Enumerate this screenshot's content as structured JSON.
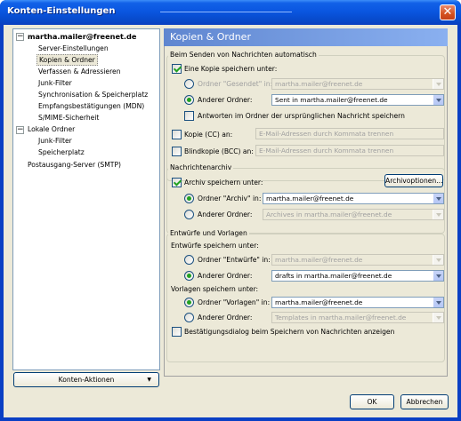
{
  "window": {
    "title": "Konten-Einstellungen",
    "close_glyph": "✕"
  },
  "tree": {
    "items": [
      {
        "label": "martha.mailer@freenet.de",
        "toggle": "−"
      },
      {
        "label": "Server-Einstellungen"
      },
      {
        "label": "Kopien & Ordner"
      },
      {
        "label": "Verfassen & Adressieren"
      },
      {
        "label": "Junk-Filter"
      },
      {
        "label": "Synchronisation & Speicherplatz"
      },
      {
        "label": "Empfangsbestätigungen (MDN)"
      },
      {
        "label": "S/MIME-Sicherheit"
      },
      {
        "label": "Lokale Ordner",
        "toggle": "−"
      },
      {
        "label": "Junk-Filter"
      },
      {
        "label": "Speicherplatz"
      },
      {
        "label": "Postausgang-Server (SMTP)"
      }
    ],
    "accounts_button": "Konten-Aktionen",
    "accounts_arrow": "▼"
  },
  "panel": {
    "title": "Kopien & Ordner",
    "send_group": {
      "label": "Beim Senden von Nachrichten automatisch",
      "save_copy": "Eine Kopie speichern unter:",
      "sent_folder_label": "Ordner \"Gesendet\" in:",
      "sent_folder_value": "martha.mailer@freenet.de",
      "other_folder_label": "Anderer Ordner:",
      "other_folder_value": "Sent in martha.mailer@freenet.de",
      "reply_in_folder": "Antworten im Ordner der ursprünglichen Nachricht speichern",
      "cc_label": "Kopie (CC) an:",
      "cc_placeholder": "E-Mail-Adressen durch Kommata trennen",
      "bcc_label": "Blindkopie (BCC) an:",
      "bcc_placeholder": "E-Mail-Adressen durch Kommata trennen"
    },
    "archive_group": {
      "label": "Nachrichtenarchiv",
      "save_archive": "Archiv speichern unter:",
      "options_button": "Archivoptionen...",
      "archive_folder_label": "Ordner \"Archiv\" in:",
      "archive_folder_value": "martha.mailer@freenet.de",
      "other_folder_label": "Anderer Ordner:",
      "other_folder_value": "Archives in martha.mailer@freenet.de"
    },
    "drafts_group": {
      "label": "Entwürfe und Vorlagen",
      "drafts_save_label": "Entwürfe speichern unter:",
      "drafts_folder_label": "Ordner \"Entwürfe\" in:",
      "drafts_folder_value": "martha.mailer@freenet.de",
      "drafts_other_label": "Anderer Ordner:",
      "drafts_other_value": "drafts in martha.mailer@freenet.de",
      "templates_save_label": "Vorlagen speichern unter:",
      "templates_folder_label": "Ordner \"Vorlagen\" in:",
      "templates_folder_value": "martha.mailer@freenet.de",
      "templates_other_label": "Anderer Ordner:",
      "templates_other_value": "Templates in martha.mailer@freenet.de",
      "confirm_dialog": "Bestätigungsdialog beim Speichern von Nachrichten anzeigen"
    }
  },
  "footer": {
    "ok": "OK",
    "cancel": "Abbrechen"
  }
}
